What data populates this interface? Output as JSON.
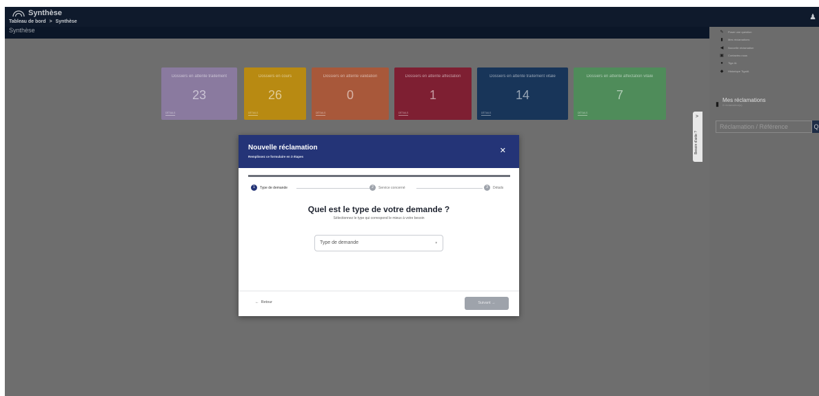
{
  "header": {
    "app_title": "Synthèse",
    "breadcrumb_parent": "Tableau de bord",
    "breadcrumb_sep": ">",
    "breadcrumb_current": "Synthèse",
    "page_title": "Synthèse"
  },
  "cards": [
    {
      "title": "Dossiers en attente traitement",
      "value": "23",
      "detail": "DÉTAILS",
      "color": "#8a7a9f"
    },
    {
      "title": "Dossiers en cours",
      "value": "26",
      "detail": "DÉTAILS",
      "color": "#b88a12"
    },
    {
      "title": "Dossiers en attente validation",
      "value": "0",
      "detail": "DÉTAILS",
      "color": "#a8583a"
    },
    {
      "title": "Dossiers en attente affectation",
      "value": "1",
      "detail": "DÉTAILS",
      "color": "#7e1f32"
    },
    {
      "title": "Dossiers en attente traitement vitale",
      "value": "14",
      "detail": "DÉTAILS",
      "color": "#183559"
    },
    {
      "title": "Dossiers en attente affectation vitale",
      "value": "7",
      "detail": "DÉTAILS",
      "color": "#4f8c5a"
    }
  ],
  "right_panel": {
    "menu": [
      {
        "icon": "pencil-icon",
        "glyph": "✎",
        "label": "Poser une question"
      },
      {
        "icon": "document-icon",
        "glyph": "▮",
        "label": "Mes réclamations"
      },
      {
        "icon": "megaphone-icon",
        "glyph": "◀",
        "label": "Nouvelle réclamation"
      },
      {
        "icon": "contact-icon",
        "glyph": "▣",
        "label": "Contactez-nous"
      },
      {
        "icon": "chat-icon",
        "glyph": "●",
        "label": "Tiga IA"
      },
      {
        "icon": "history-icon",
        "glyph": "◆",
        "label": "Historique TigaIA"
      }
    ],
    "title": "Mes réclamations",
    "subtitle": "0 réclamation(s)",
    "search_placeholder": "Réclamation / Référence",
    "search_button": "Q",
    "help_tab_arrow": ">",
    "help_tab_label": "Besoin d'aide ?"
  },
  "modal": {
    "title": "Nouvelle réclamation",
    "subtitle": "Remplissez ce formulaire en 3 étapes",
    "close": "✕",
    "steps": [
      {
        "num": "1",
        "label": "Type de demande"
      },
      {
        "num": "2",
        "label": "Service concerné"
      },
      {
        "num": "3",
        "label": "Détails"
      }
    ],
    "question": "Quel est le type de votre demande ?",
    "question_sub": "Sélectionnez le type qui correspond le mieux à votre besoin",
    "select_placeholder": "Type de demande",
    "select_caret": "▾",
    "back_arrow": "←",
    "back_label": "Retour",
    "next_label": "Suivant →"
  }
}
